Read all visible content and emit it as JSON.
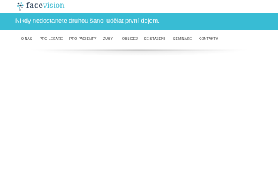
{
  "header": {
    "logo_text_main": "face",
    "logo_text_accent": "vision"
  },
  "banner": {
    "tagline": "Nikdy nedostanete druhou šanci udělat první dojem."
  },
  "nav": {
    "items": [
      {
        "label": "O NÁS"
      },
      {
        "label": "PRO LÉKAŘE"
      },
      {
        "label": "PRO PACIENTY"
      },
      {
        "label": "ZUBY"
      },
      {
        "label": "OBLIČEJ"
      },
      {
        "label": "KE STAŽENÍ"
      },
      {
        "label": "SEMINÁŘE"
      },
      {
        "label": "KONTAKTY"
      }
    ]
  },
  "colors": {
    "banner": "#38bcd4",
    "logo_dark": "#2b3f56",
    "logo_accent": "#37b8d0",
    "nav_text": "#333333",
    "tagline_text": "#ffffff"
  }
}
